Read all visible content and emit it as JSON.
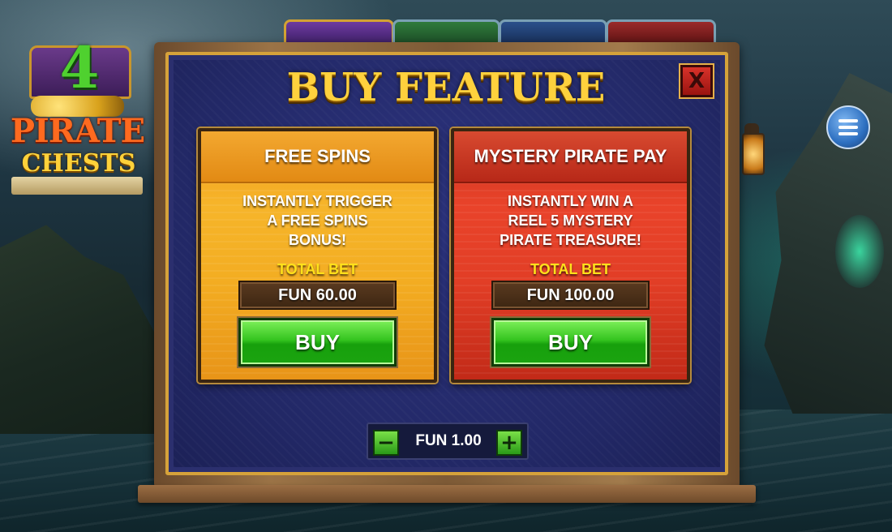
{
  "game": {
    "logo": {
      "number": "4",
      "line1": "PIRATE",
      "line2": "CHESTS"
    }
  },
  "dialog": {
    "title": "BUY FEATURE",
    "close_label": "X"
  },
  "features": [
    {
      "name": "FREE SPINS",
      "description": [
        "INSTANTLY TRIGGER",
        "A FREE SPINS",
        "BONUS!"
      ],
      "total_bet_label": "TOTAL BET",
      "price": "FUN 60.00",
      "buy_label": "BUY"
    },
    {
      "name": "MYSTERY PIRATE PAY",
      "description": [
        "INSTANTLY WIN A",
        "REEL 5 MYSTERY",
        "PIRATE TREASURE!"
      ],
      "total_bet_label": "TOTAL BET",
      "price": "FUN 100.00",
      "buy_label": "BUY"
    }
  ],
  "bet": {
    "minus_label": "−",
    "value": "FUN 1.00",
    "plus_label": "+"
  },
  "icons": {
    "menu": "hamburger-menu-icon",
    "lantern": "lantern-icon"
  },
  "colors": {
    "title_gold": "#ffd13d",
    "free_spins_card": "#f3ad22",
    "mystery_card": "#e23e26",
    "buy_green": "#34c41f",
    "total_bet_yellow": "#ffe11a",
    "panel_navy": "#222866"
  }
}
